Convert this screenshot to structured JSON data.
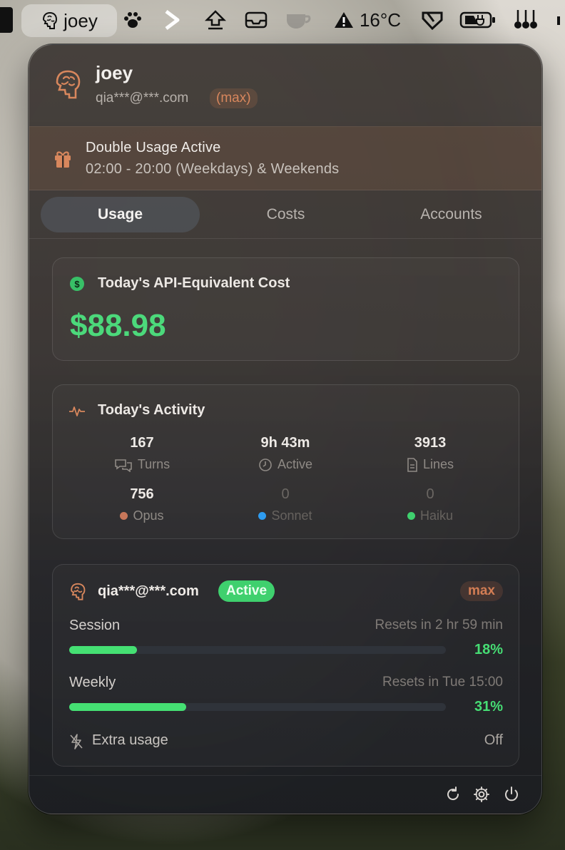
{
  "menubar": {
    "user_name": "joey",
    "temperature": "16°C"
  },
  "header": {
    "name": "joey",
    "email": "qia***@***.com",
    "plan": "(max)"
  },
  "promo": {
    "title": "Double Usage Active",
    "subtitle": "02:00 - 20:00 (Weekdays) & Weekends"
  },
  "tabs": [
    {
      "label": "Usage",
      "active": true
    },
    {
      "label": "Costs",
      "active": false
    },
    {
      "label": "Accounts",
      "active": false
    }
  ],
  "cost_card": {
    "title": "Today's API-Equivalent Cost",
    "value": "$88.98",
    "icon_glyph": "$"
  },
  "activity": {
    "title": "Today's Activity",
    "stats": [
      {
        "value": "167",
        "label": "Turns",
        "icon": "chat-bubbles-icon"
      },
      {
        "value": "9h 43m",
        "label": "Active",
        "icon": "clock-icon"
      },
      {
        "value": "3913",
        "label": "Lines",
        "icon": "document-icon"
      }
    ],
    "models": [
      {
        "value": "756",
        "label": "Opus",
        "color": "#c8775a"
      },
      {
        "value": "0",
        "label": "Sonnet",
        "color": "#2e9cf0"
      },
      {
        "value": "0",
        "label": "Haiku",
        "color": "#3fd06e"
      }
    ]
  },
  "account": {
    "email": "qia***@***.com",
    "status": "Active",
    "plan": "max",
    "session": {
      "label": "Session",
      "reset": "Resets in 2 hr 59 min",
      "percent_text": "18%",
      "percent": 18
    },
    "weekly": {
      "label": "Weekly",
      "reset": "Resets in Tue 15:00",
      "percent_text": "31%",
      "percent": 31
    },
    "extra_usage": {
      "label": "Extra usage",
      "value": "Off"
    }
  },
  "colors": {
    "accent_green": "#45e073",
    "accent_orange": "#d8875d"
  }
}
